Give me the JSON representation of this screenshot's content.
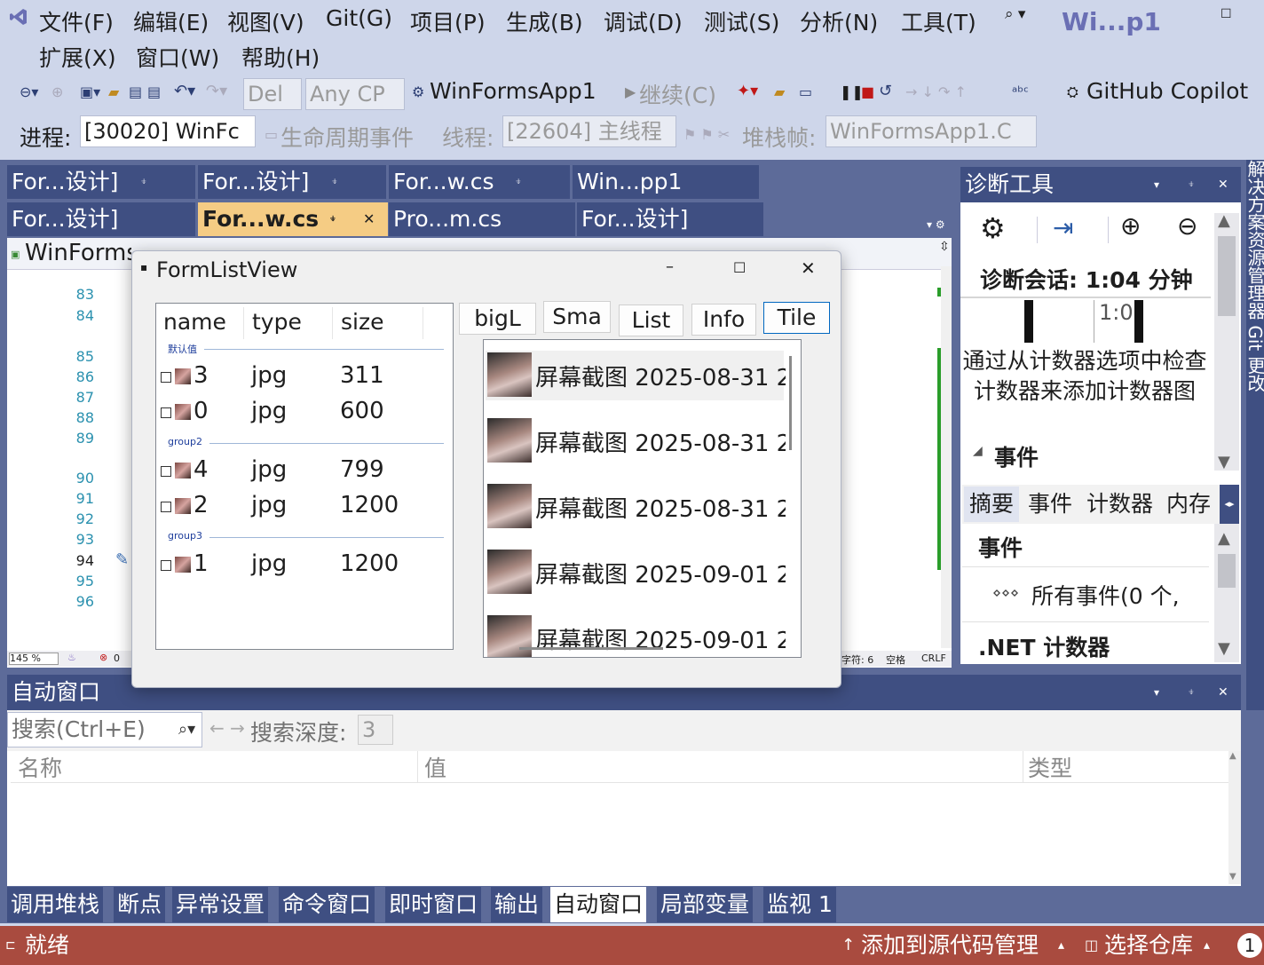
{
  "menu": {
    "items": [
      "文件(F)",
      "编辑(E)",
      "视图(V)",
      "Git(G)",
      "项目(P)",
      "生成(B)",
      "调试(D)",
      "测试(S)",
      "分析(N)",
      "工具(T)",
      "扩展(X)",
      "窗口(W)",
      "帮助(H)"
    ],
    "window_title": "Wi...p1"
  },
  "toolbar1": {
    "config": "Del",
    "platform": "Any CP",
    "startup_project": "WinFormsApp1",
    "continue": "继续(C)",
    "copilot": "GitHub Copilot"
  },
  "toolbar2": {
    "process_label": "进程:",
    "process_value": "[30020] WinFc",
    "lifecycle": "生命周期事件",
    "thread_label": "线程:",
    "thread_value": "[22604] 主线程",
    "stack_label": "堆栈帧:",
    "stack_value": "WinFormsApp1.C"
  },
  "doc_tabs": {
    "row1": [
      "For...设计]",
      "For...设计]",
      "For...w.cs",
      "Win...pp1"
    ],
    "row2": [
      "For...设计]",
      "For...w.cs",
      "Pro...m.cs",
      "For...设计]"
    ]
  },
  "editor": {
    "nav_left": "WinForms",
    "line_numbers": [
      "83",
      "84",
      "85",
      "86",
      "87",
      "88",
      "89",
      "90",
      "91",
      "92",
      "93",
      "94",
      "95",
      "96"
    ],
    "zoom": "145 %",
    "errors": "0",
    "status_chars": "字符: 6",
    "status_space": "空格",
    "status_crlf": "CRLF"
  },
  "diag": {
    "title": "诊断工具",
    "session": "诊断会话: 1:04 分钟",
    "timeline_label": "1:0",
    "hint": "通过从计数器选项中检查计数器来添加计数器图",
    "events_heading": "事件",
    "tabs": [
      "摘要",
      "事件",
      "计数器",
      "内存"
    ],
    "section_events": "事件",
    "all_events": "所有事件(0 个,",
    "net_counters": ".NET 计数器"
  },
  "side_strip": "解决方案资源管理器  Git 更改",
  "dialog": {
    "title": "FormListView",
    "columns": [
      "name",
      "type",
      "size"
    ],
    "groups": [
      {
        "name": "默认值",
        "rows": [
          {
            "name": "3",
            "type": "jpg",
            "size": "311"
          },
          {
            "name": "0",
            "type": "jpg",
            "size": "600"
          }
        ]
      },
      {
        "name": "group2",
        "rows": [
          {
            "name": "4",
            "type": "jpg",
            "size": "799"
          },
          {
            "name": "2",
            "type": "jpg",
            "size": "1200"
          }
        ]
      },
      {
        "name": "group3",
        "rows": [
          {
            "name": "1",
            "type": "jpg",
            "size": "1200"
          }
        ]
      }
    ],
    "view_buttons": [
      "bigL",
      "Sma",
      "List",
      "Info",
      "Tile"
    ],
    "tiles": [
      "屏幕截图 2025-08-31 2",
      "屏幕截图 2025-08-31 2",
      "屏幕截图 2025-08-31 2",
      "屏幕截图 2025-09-01 2",
      "屏幕截图 2025-09-01 2"
    ]
  },
  "autos": {
    "title": "自动窗口",
    "search_placeholder": "搜索(Ctrl+E)",
    "depth_label": "搜索深度:",
    "depth_value": "3",
    "columns": [
      "名称",
      "值",
      "类型"
    ]
  },
  "bottom_tabs": [
    "调用堆栈",
    "断点",
    "异常设置",
    "命令窗口",
    "即时窗口",
    "输出",
    "自动窗口",
    "局部变量",
    "监视 1"
  ],
  "bottom_active": "自动窗口",
  "status": {
    "ready": "就绪",
    "add_source": "添加到源代码管理",
    "select_repo": "选择仓库",
    "notifications": "1"
  }
}
